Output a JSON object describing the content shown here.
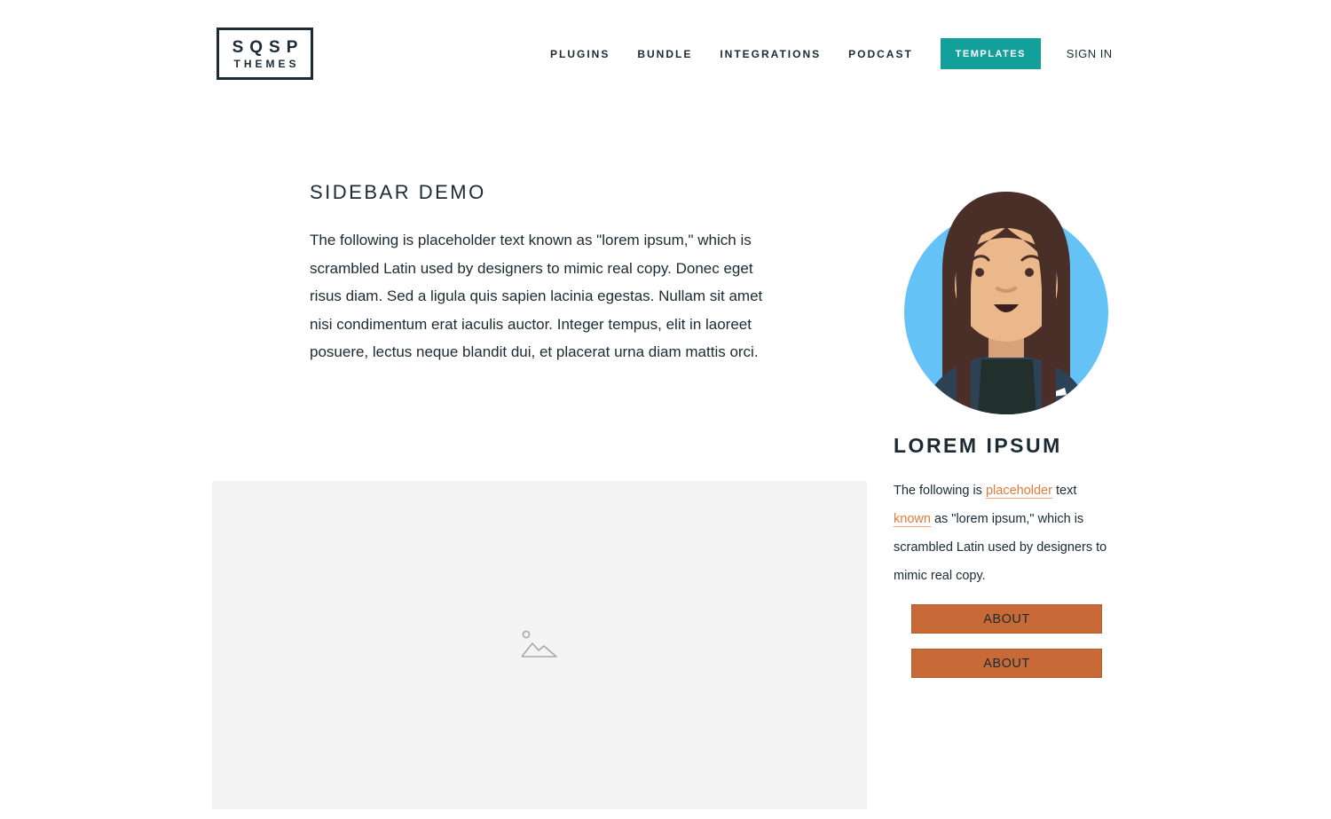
{
  "brand": {
    "logo_line1": "SQSP",
    "logo_line2": "THEMES"
  },
  "nav": {
    "items": [
      "PLUGINS",
      "BUNDLE",
      "INTEGRATIONS",
      "PODCAST"
    ],
    "cta_label": "TEMPLATES",
    "signin_label": "SIGN IN"
  },
  "main": {
    "title": "SIDEBAR DEMO",
    "body": "The following is placeholder text known as \"lorem ipsum,\" which is scrambled Latin used by designers to mimic real copy. Donec eget risus diam. Sed a ligula quis sapien lacinia egestas. Nullam sit amet nisi condimentum erat iaculis auctor. Integer tempus, elit in laoreet posuere, lectus neque blandit dui, et placerat urna diam mattis orci.",
    "image_icon": "image-placeholder-icon"
  },
  "sidebar": {
    "title": "LOREM IPSUM",
    "text_1": "The following is ",
    "link_1": "placeholder",
    "text_2": " text ",
    "link_2": "known",
    "text_3": " as \"lorem ipsum,\" which is scrambled Latin used by designers to mimic real copy.",
    "button_1": "ABOUT",
    "button_2": "ABOUT"
  },
  "colors": {
    "accent_teal": "#14a09a",
    "link_orange": "#e8793a",
    "button_orange": "#c76a37",
    "text_dark": "#1b2a33",
    "placeholder_gray": "#f4f4f4",
    "avatar_bg": "#64c2f7"
  }
}
